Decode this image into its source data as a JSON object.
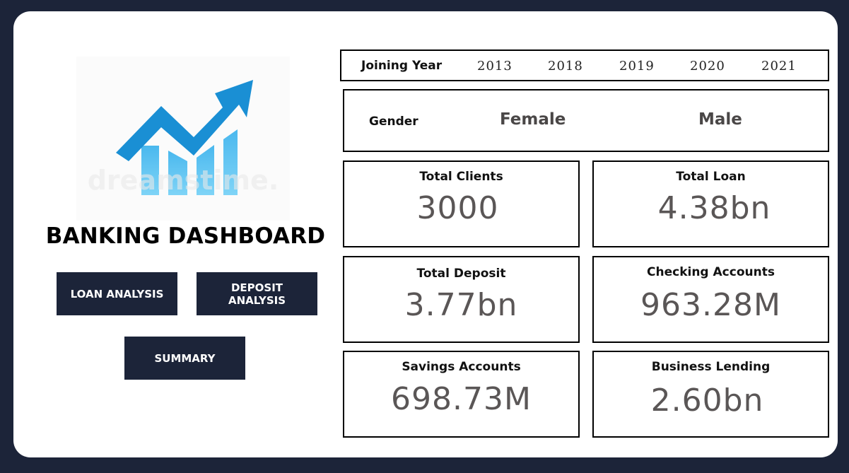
{
  "sidebar": {
    "title": "BANKING DASHBOARD",
    "buttons": {
      "loan": "LOAN ANALYSIS",
      "deposit": "DEPOSIT ANALYSIS",
      "summary": "SUMMARY"
    },
    "logo": {
      "icon": "trending-up-chart-icon",
      "watermark": "dreamstime."
    }
  },
  "filters": {
    "joining_year": {
      "label": "Joining Year",
      "years": [
        "2013",
        "2018",
        "2019",
        "2020",
        "2021"
      ]
    },
    "gender": {
      "label": "Gender",
      "options": [
        "Female",
        "Male"
      ]
    }
  },
  "kpis": {
    "total_clients": {
      "label": "Total Clients",
      "value": "3000"
    },
    "total_loan": {
      "label": "Total Loan",
      "value": "4.38bn"
    },
    "total_deposit": {
      "label": "Total Deposit",
      "value": "3.77bn"
    },
    "checking_accounts": {
      "label": "Checking Accounts",
      "value": "963.28M"
    },
    "savings_accounts": {
      "label": "Savings Accounts",
      "value": "698.73M"
    },
    "business_lending": {
      "label": "Business Lending",
      "value": "2.60bn"
    }
  },
  "colors": {
    "background": "#1c2439",
    "card": "#ffffff",
    "button": "#1c2439",
    "chart_blue": "#1a8fd4",
    "chart_light_blue": "#5ec4f2",
    "kpi_value": "#5a5656"
  }
}
